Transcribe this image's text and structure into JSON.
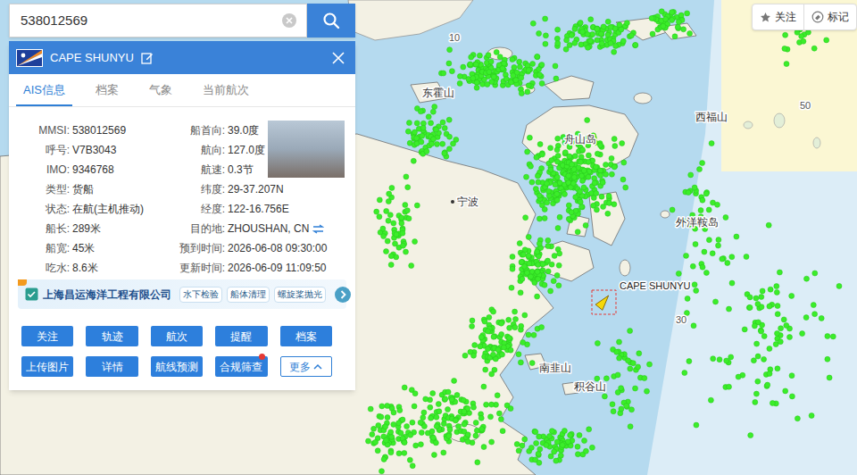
{
  "search": {
    "value": "538012569"
  },
  "ship": {
    "name": "CAPE SHUNYU"
  },
  "tabs": [
    {
      "label": "AIS信息",
      "selected": true
    },
    {
      "label": "档案",
      "selected": false
    },
    {
      "label": "气象",
      "selected": false
    },
    {
      "label": "当前航次",
      "selected": false
    }
  ],
  "info": {
    "left": [
      {
        "label": "MMSI:",
        "value": "538012569"
      },
      {
        "label": "呼号:",
        "value": "V7B3043"
      },
      {
        "label": "IMO:",
        "value": "9346768"
      },
      {
        "label": "类型:",
        "value": "货船"
      },
      {
        "label": "状态:",
        "value": "在航(主机推动)"
      },
      {
        "label": "船长:",
        "value": "289米"
      },
      {
        "label": "船宽:",
        "value": "45米"
      },
      {
        "label": "吃水:",
        "value": "8.6米"
      }
    ],
    "right": [
      {
        "label": "船首向:",
        "value": "39.0度",
        "kind": "plain"
      },
      {
        "label": "航向:",
        "value": "127.0度",
        "kind": "plain"
      },
      {
        "label": "航速:",
        "value": "0.3节",
        "kind": "plain"
      },
      {
        "label": "纬度:",
        "value": "29-37.207N",
        "kind": "plain"
      },
      {
        "label": "经度:",
        "value": "122-16.756E",
        "kind": "plain"
      },
      {
        "label": "目的地:",
        "value": "ZHOUSHAN, CN",
        "kind": "switch"
      },
      {
        "label": "预到时间:",
        "value": "2026-06-08 09:30:00",
        "kind": "plain"
      },
      {
        "label": "更新时间:",
        "value": "2026-06-09 11:09:50",
        "kind": "plain"
      }
    ]
  },
  "ad": {
    "company": "上海昌运海洋工程有限公司",
    "tags": [
      "水下检验",
      "船体清理",
      "螺旋桨抛光"
    ]
  },
  "buttons": [
    {
      "label": "关注",
      "kind": "primary",
      "badge": false
    },
    {
      "label": "轨迹",
      "kind": "primary",
      "badge": false
    },
    {
      "label": "航次",
      "kind": "primary",
      "badge": false
    },
    {
      "label": "提醒",
      "kind": "primary",
      "badge": false
    },
    {
      "label": "档案",
      "kind": "primary",
      "badge": false
    },
    {
      "label": "上传图片",
      "kind": "primary",
      "badge": false
    },
    {
      "label": "详情",
      "kind": "primary",
      "badge": false
    },
    {
      "label": "航线预测",
      "kind": "primary",
      "badge": false
    },
    {
      "label": "合规筛查",
      "kind": "primary",
      "badge": true
    },
    {
      "label": "更多",
      "kind": "more",
      "badge": false
    }
  ],
  "toolbar": [
    {
      "label": "关注"
    },
    {
      "label": "标记"
    }
  ],
  "map": {
    "labels": [
      {
        "text": "10",
        "kind": "depth"
      },
      {
        "text": "东霍山",
        "kind": "place"
      },
      {
        "text": "舟山岛",
        "kind": "place"
      },
      {
        "text": "宁波",
        "kind": "city"
      },
      {
        "text": "外洋鞍岛",
        "kind": "place"
      },
      {
        "text": "西福山",
        "kind": "place"
      },
      {
        "text": "50",
        "kind": "depth"
      },
      {
        "text": "30",
        "kind": "depth"
      },
      {
        "text": "南韭山",
        "kind": "place"
      },
      {
        "text": "积谷山",
        "kind": "place"
      }
    ],
    "ship_label": "CAPE SHUNYU"
  }
}
